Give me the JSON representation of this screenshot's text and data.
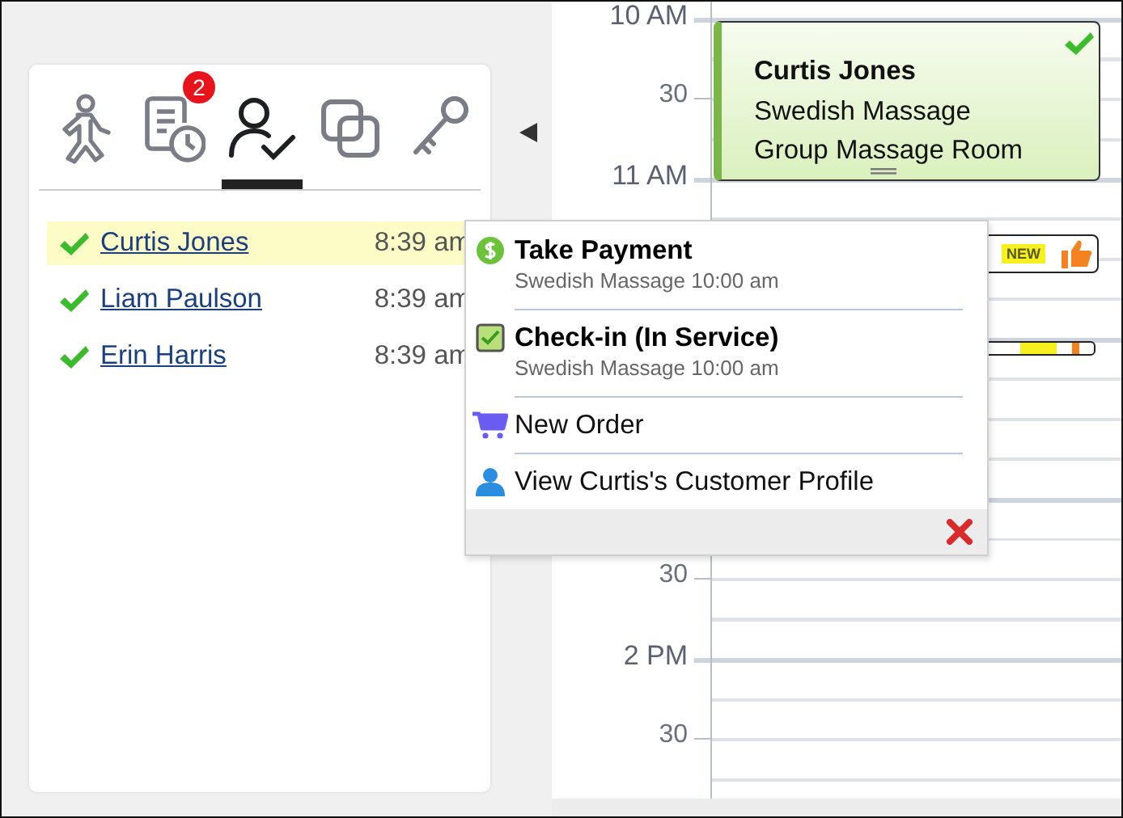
{
  "tabs": [
    {
      "selected": false
    },
    {
      "selected": false,
      "badge": "2"
    },
    {
      "selected": true
    },
    {
      "selected": false
    },
    {
      "selected": false
    }
  ],
  "clients": [
    {
      "name": "Curtis Jones",
      "time": "8:39 am",
      "checked_in": true,
      "selected": true
    },
    {
      "name": "Liam Paulson",
      "time": "8:39 am",
      "checked_in": true,
      "selected": false
    },
    {
      "name": "Erin Harris",
      "time": "8:39 am",
      "checked_in": true,
      "selected": false
    }
  ],
  "calendar": {
    "time_slots": [
      {
        "kind": "hour",
        "label": "10 AM"
      },
      {
        "kind": "half",
        "label": "30"
      },
      {
        "kind": "hour",
        "label": "11 AM"
      },
      {
        "kind": "half"
      },
      {
        "kind": "hour"
      },
      {
        "kind": "half"
      },
      {
        "kind": "hour"
      },
      {
        "kind": "half",
        "label": "30"
      },
      {
        "kind": "hour",
        "label": "2 PM"
      },
      {
        "kind": "half",
        "label": "30"
      }
    ],
    "appointments": [
      {
        "kind": "card",
        "client": "Curtis Jones",
        "service": "Swedish Massage",
        "room": "Group Massage Room",
        "checked_in": true
      },
      {
        "kind": "tag",
        "badge": "NEW",
        "liked": true
      },
      {
        "kind": "stub"
      }
    ]
  },
  "context_menu": {
    "items": [
      {
        "kind": "action",
        "label": "Take Payment",
        "detail": "Swedish Massage 10:00 am"
      },
      {
        "kind": "action",
        "label": "Check-in (In Service)",
        "detail": "Swedish Massage 10:00 am"
      },
      {
        "kind": "link",
        "label": "New Order"
      },
      {
        "kind": "link",
        "label": "View Curtis's Customer Profile"
      }
    ]
  }
}
